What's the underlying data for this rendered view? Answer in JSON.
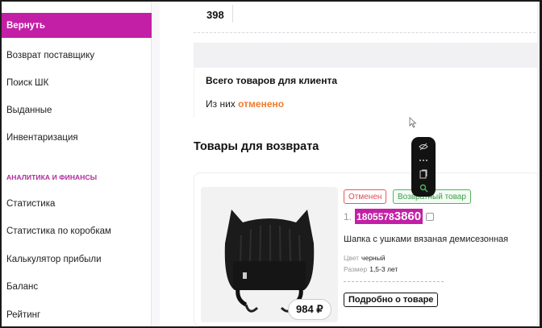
{
  "sidebar": {
    "items": [
      {
        "label": "Вернуть",
        "active": true
      },
      {
        "label": "Возврат поставщику"
      },
      {
        "label": "Поиск ШК"
      },
      {
        "label": "Выданные"
      },
      {
        "label": "Инвентаризация"
      }
    ],
    "section_label": "АНАЛИТИКА И ФИНАНСЫ",
    "section_items": [
      {
        "label": "Статистика"
      },
      {
        "label": "Статистика по коробкам"
      },
      {
        "label": "Калькулятор прибыли"
      },
      {
        "label": "Баланс"
      },
      {
        "label": "Рейтинг"
      }
    ]
  },
  "top": {
    "number": "398"
  },
  "summary": {
    "title": "Всего товаров для клиента",
    "line_prefix": "Из них",
    "line_accent": "отменено"
  },
  "returns": {
    "title": "Товары для возврата",
    "card": {
      "badge_cancelled": "Отменен",
      "badge_return": "Возвратный товар",
      "index": "1.",
      "barcode_main": "1805578",
      "barcode_tail": "3860",
      "name": "Шапка с ушками вязаная демисезонная",
      "color_label": "Цвет",
      "color_value": "черный",
      "size_label": "Размер",
      "size_value": "1,5-3 лет",
      "price": "984 ₽",
      "details_button": "Подробно о товаре"
    }
  },
  "icons": [
    "eye-off-icon",
    "more-icon",
    "copy-icon",
    "search-icon",
    "cursor-icon"
  ],
  "colors": {
    "accent": "#c31fa6",
    "cancel": "#e04b4f",
    "return": "#3a9f4a",
    "orange": "#f07a2c"
  }
}
